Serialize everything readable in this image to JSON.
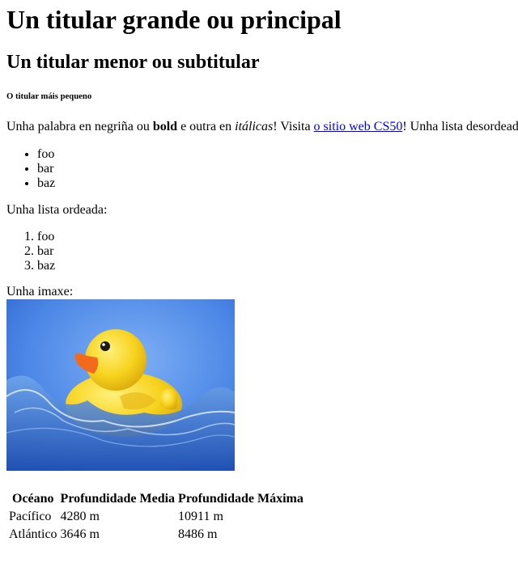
{
  "headings": {
    "h1": "Un titular grande ou principal",
    "h2": "Un titular menor ou subtitular",
    "h6": "O titular máis pequeno"
  },
  "intro": {
    "text1": "Unha palabra en negriña ou ",
    "bold": "bold",
    "text2": " e outra en ",
    "italic": "itálicas",
    "text3": "! Visita ",
    "link": "o sitio web CS50",
    "text4": "! Unha lista desordeada:"
  },
  "unordered_list": [
    "foo",
    "bar",
    "baz"
  ],
  "ordered_label": "Unha lista ordeada:",
  "ordered_list": [
    "foo",
    "bar",
    "baz"
  ],
  "image_label": "Unha imaxe:",
  "table": {
    "headers": [
      "Océano",
      "Profundidade Media",
      "Profundidade Máxima"
    ],
    "rows": [
      [
        "Pacífico",
        "4280 m",
        "10911 m"
      ],
      [
        "Atlántico",
        "3646 m",
        "8486 m"
      ]
    ]
  },
  "colors": {
    "link": "#0000ee",
    "sky": "#3f7fe0",
    "duck": "#f7d21c",
    "beak": "#f26a1b"
  },
  "icons": {
    "image": "rubber-duck-image"
  }
}
